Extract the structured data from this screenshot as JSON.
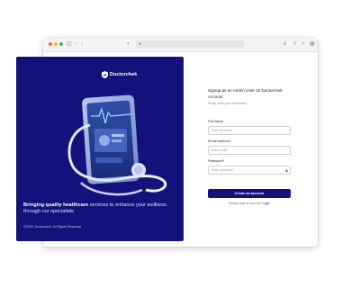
{
  "browser": {
    "window_controls": [
      "close",
      "minimize",
      "maximize"
    ],
    "colors": {
      "close": "#ff5f57",
      "minimize": "#febc2e",
      "maximize": "#28c840"
    },
    "icons": [
      "sidebar-icon",
      "back-icon",
      "forward-icon",
      "privacy-icon",
      "lock-icon",
      "download-icon",
      "share-icon",
      "new-tab-icon",
      "tabs-icon"
    ]
  },
  "hero": {
    "brand": "Doctorchek",
    "tagline_bold": "Bringing quality healthcare",
    "tagline_rest": " services to enhance your wellness through our specialists",
    "copyright": "©2025. Doctorchek. All Rights Reserved",
    "background": "#13127a"
  },
  "form": {
    "title": "Signup as an Admin User on  Doctorchek Account",
    "subtitle": "Kindly enter your credentials",
    "full_name": {
      "label": "Full Name",
      "placeholder": "Enter full name"
    },
    "email": {
      "label": "Email Address*",
      "placeholder": "Enter email"
    },
    "password": {
      "label": "Password*",
      "placeholder": "Enter password",
      "icon": "eye-icon"
    },
    "submit_label": "Create an account",
    "login_prompt": "Already have an account? ",
    "login_link": "Login",
    "accent": "#13127a"
  }
}
